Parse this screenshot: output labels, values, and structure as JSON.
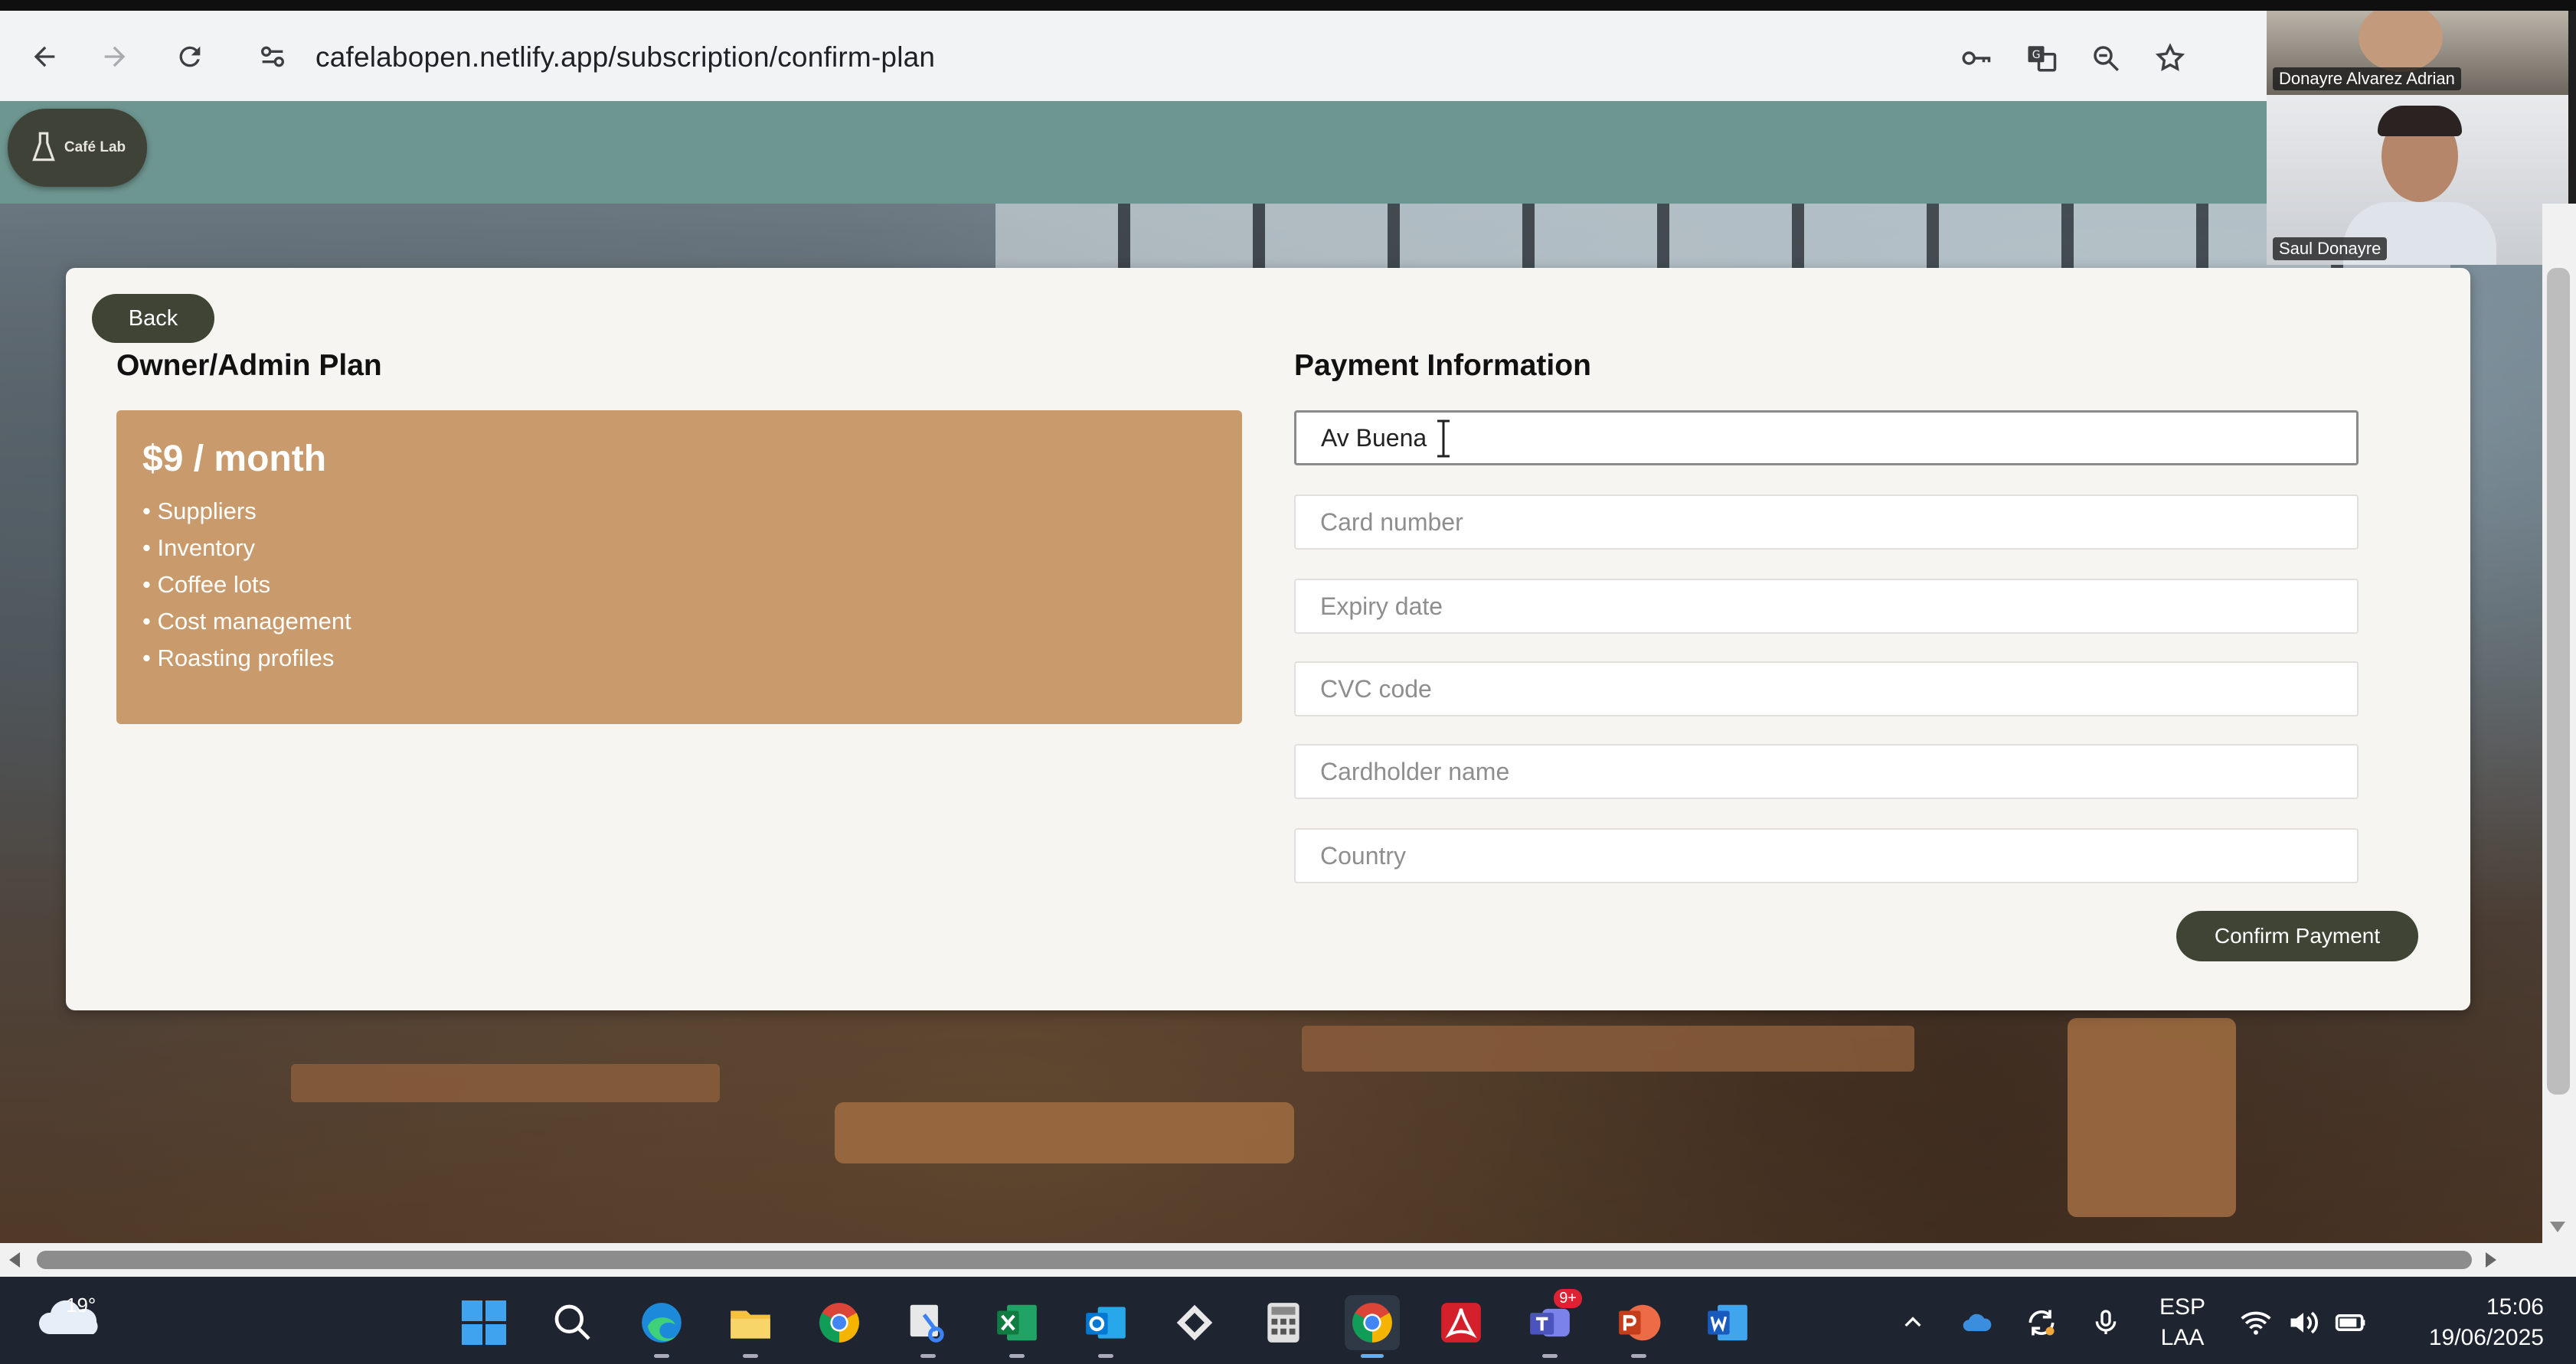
{
  "browser": {
    "url": "cafelabopen.netlify.app/subscription/confirm-plan"
  },
  "app": {
    "logo_text": "Café Lab",
    "back_label": "Back"
  },
  "plan": {
    "title": "Owner/Admin Plan",
    "price": "$9 / month",
    "features": [
      "Suppliers",
      "Inventory",
      "Coffee lots",
      "Cost management",
      "Roasting profiles"
    ]
  },
  "payment": {
    "title": "Payment Information",
    "address_value": "Av Buena",
    "card_placeholder": "Card number",
    "expiry_placeholder": "Expiry date",
    "cvc_placeholder": "CVC code",
    "cardholder_placeholder": "Cardholder name",
    "country_placeholder": "Country",
    "confirm_label": "Confirm Payment"
  },
  "video_call": {
    "participant_1": "Donayre Alvarez Adrian",
    "participant_2": "Saul Donayre"
  },
  "taskbar": {
    "temperature": "19°",
    "language": "ESP",
    "layout": "LAA",
    "time": "15:06",
    "date": "19/06/2025",
    "teams_badge": "9+"
  },
  "colors": {
    "header": "#6e9690",
    "plan_box": "#c89a6c",
    "button_dark": "#3f4434",
    "card": "#f7f5f1"
  }
}
